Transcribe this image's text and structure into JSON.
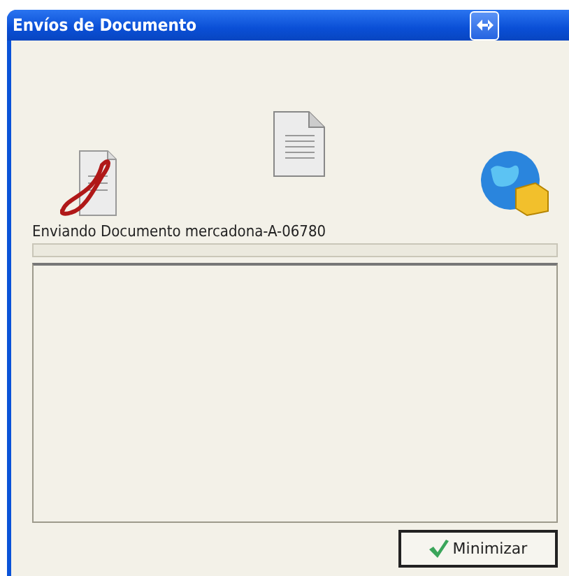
{
  "window": {
    "title": "Envíos de Documento"
  },
  "status": {
    "text": "Enviando Documento mercadona-A-06780",
    "level": 0
  },
  "buttons": [
    {
      "label": "Minimizar"
    }
  ]
}
